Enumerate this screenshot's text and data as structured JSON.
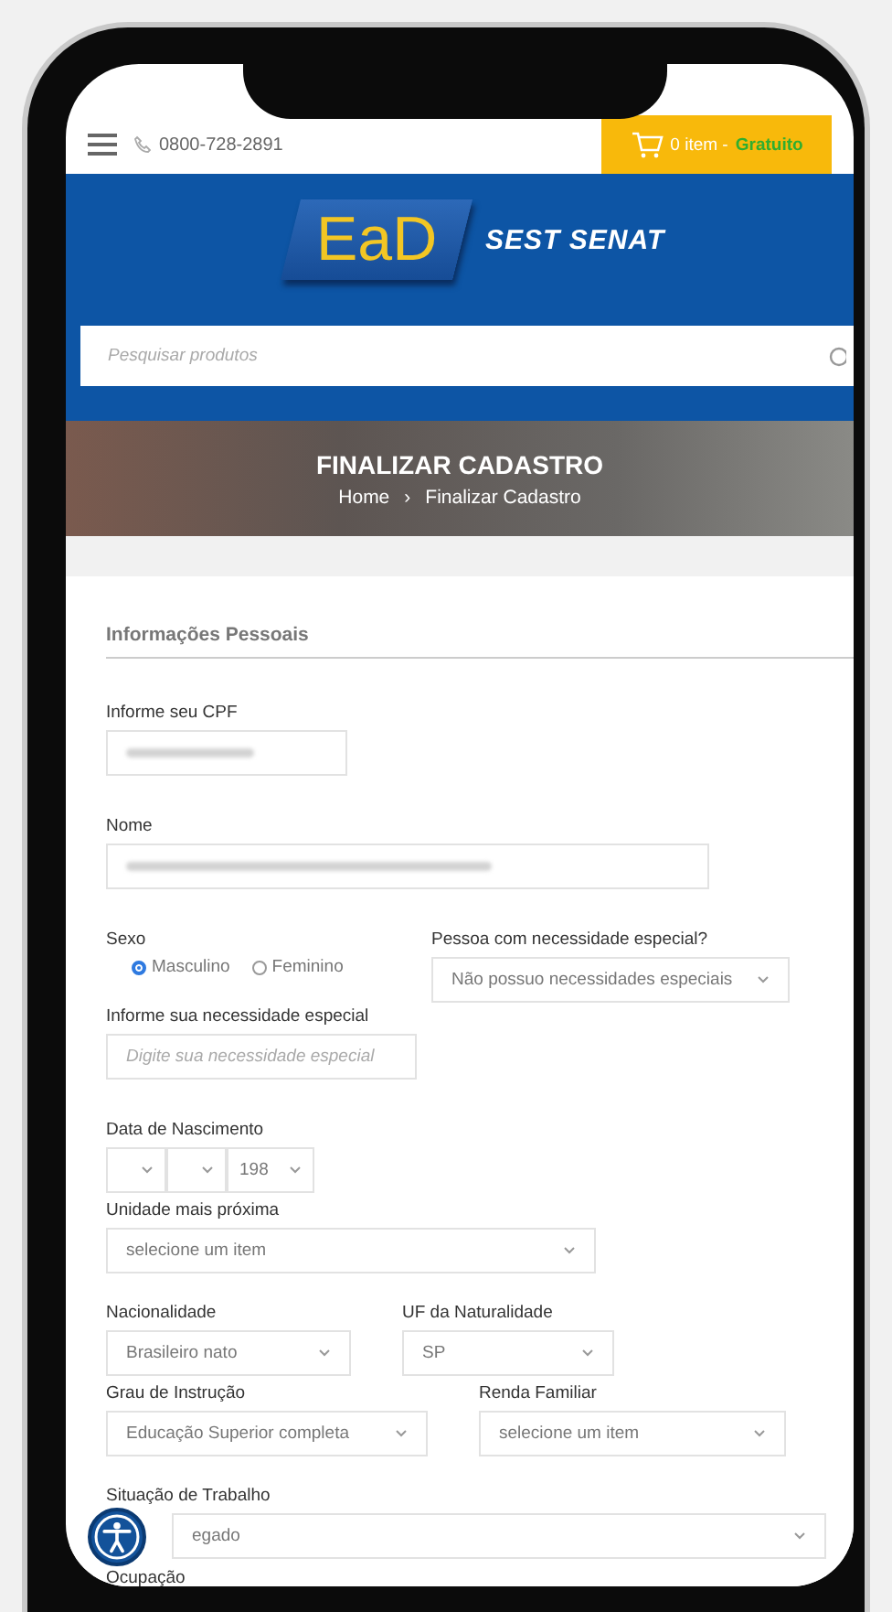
{
  "top_bar": {
    "phone": "0800-728-2891",
    "cart": {
      "count": "0 item -",
      "price": "Gratuito"
    }
  },
  "header": {
    "logo": {
      "mark": "EaD",
      "name": "SEST SENAT"
    },
    "search": {
      "placeholder": "Pesquisar produtos"
    }
  },
  "hero": {
    "title": "FINALIZAR CADASTRO",
    "breadcrumb": [
      "Home",
      "Finalizar Cadastro"
    ],
    "separator": "›"
  },
  "form": {
    "section_title": "Informações Pessoais",
    "rows": [
      [
        {
          "kind": "masked",
          "label": "Informe seu CPF"
        }
      ],
      [
        {
          "kind": "masked",
          "label": "Nome"
        }
      ],
      [
        {
          "kind": "radio",
          "label": "Sexo",
          "options": [
            {
              "label": "Masculino",
              "selected": true
            },
            {
              "label": "Feminino",
              "selected": false
            }
          ]
        },
        {
          "kind": "select",
          "label": "Pessoa com necessidade especial?",
          "value": "Não possuo necessidades especiais"
        }
      ],
      [
        {
          "kind": "input",
          "label": "Informe sua necessidade especial",
          "placeholder": "Digite sua necessidade especial"
        }
      ],
      [
        {
          "kind": "date",
          "label": "Data de Nascimento",
          "year": "198"
        }
      ],
      [
        {
          "kind": "select",
          "label": "Unidade mais próxima",
          "value": "selecione um item"
        }
      ],
      [
        {
          "kind": "select",
          "label": "Nacionalidade",
          "value": "Brasileiro nato"
        },
        {
          "kind": "select",
          "label": "UF da Naturalidade",
          "value": "SP"
        }
      ],
      [
        {
          "kind": "select",
          "label": "Grau de Instrução",
          "value": "Educação Superior completa"
        },
        {
          "kind": "select",
          "label": "Renda Familiar",
          "value": "selecione um item"
        }
      ],
      [
        {
          "kind": "select",
          "label": "Situação de Trabalho",
          "value": "egado"
        }
      ],
      [
        {
          "kind": "cut",
          "label": "Ocupação"
        }
      ]
    ]
  }
}
